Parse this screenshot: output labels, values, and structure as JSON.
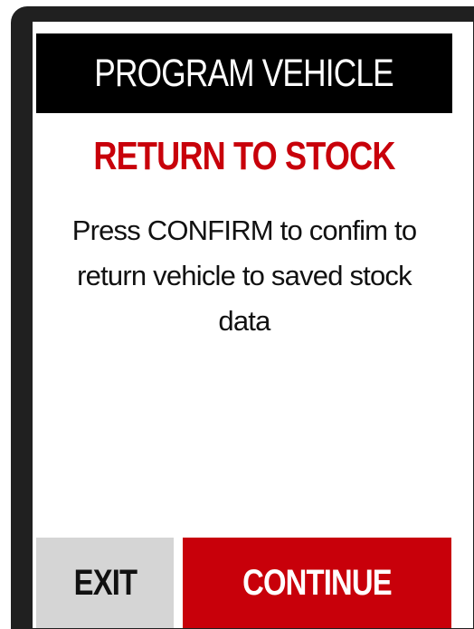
{
  "header": {
    "title": "PROGRAM VEHICLE"
  },
  "content": {
    "subtitle": "RETURN TO STOCK",
    "message": "Press CONFIRM to confim to return vehicle to saved stock data"
  },
  "buttons": {
    "exit_label": "EXIT",
    "continue_label": "CONTINUE"
  },
  "colors": {
    "accent": "#c8000a",
    "header_bg": "#000000",
    "exit_bg": "#d5d5d5",
    "bezel": "#202020"
  }
}
